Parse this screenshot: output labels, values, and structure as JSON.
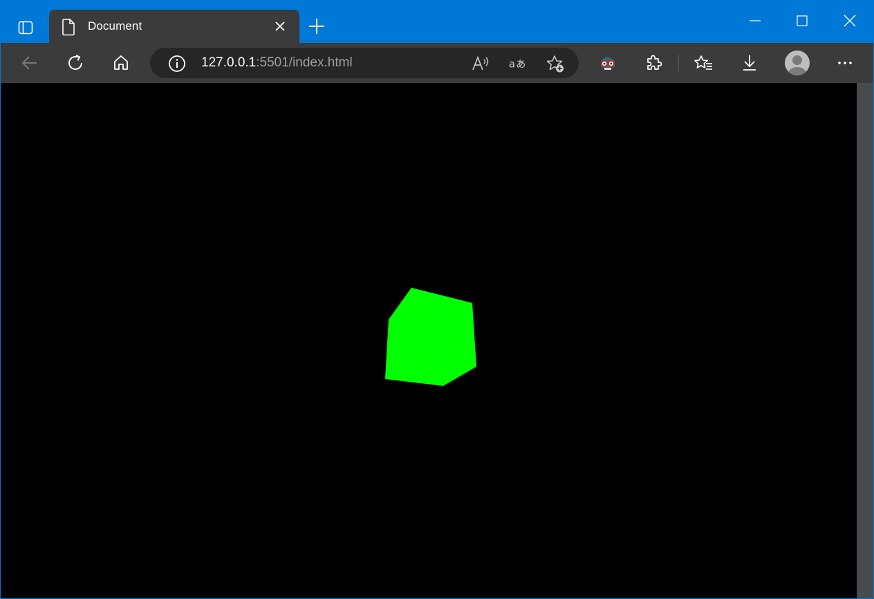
{
  "tab": {
    "title": "Document"
  },
  "address": {
    "host": "127.0.0.1",
    "rest": ":5501/index.html"
  },
  "scene": {
    "object": "cube",
    "color": "#00ff00",
    "background": "#000000"
  },
  "colors": {
    "titlebar": "#0078d7",
    "toolbar": "#3b3b3b",
    "addressbar": "#262626"
  },
  "icons": {
    "tab_actions": "tab-actions-icon",
    "back": "back-arrow-icon",
    "refresh": "refresh-icon",
    "home": "home-icon",
    "read_aloud": "read-aloud-icon",
    "translate": "translate-icon",
    "add_favorite": "add-favorite-icon",
    "extension_glasses": "extension-glasses-icon",
    "extensions": "extensions-puzzle-icon",
    "favorites": "favorites-icon",
    "downloads": "downloads-icon",
    "profile": "profile-avatar",
    "more": "more-options-icon"
  }
}
